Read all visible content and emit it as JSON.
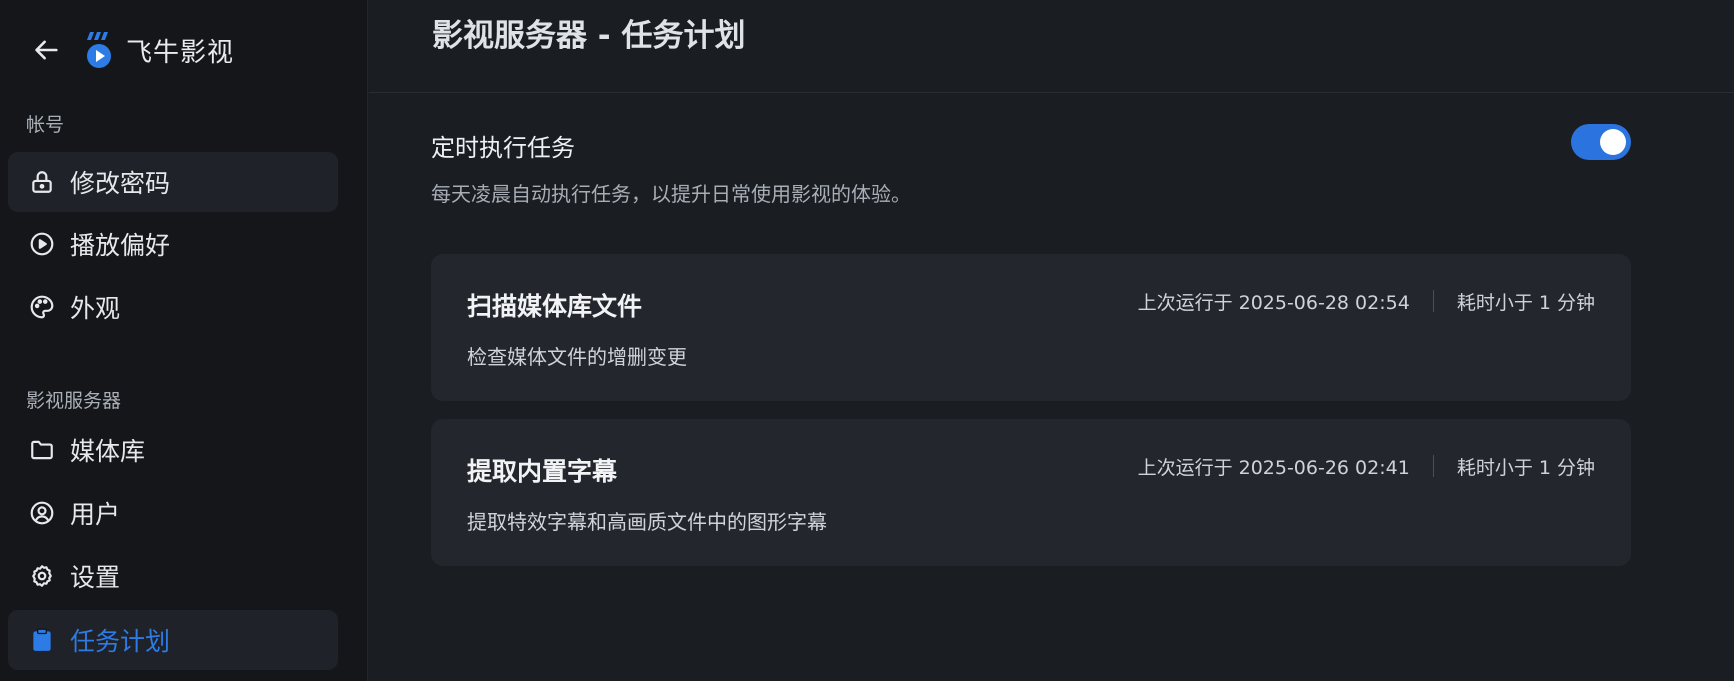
{
  "brand": {
    "name": "飞牛影视"
  },
  "sidebar": {
    "sections": [
      {
        "label": "帐号"
      },
      {
        "label": "影视服务器"
      }
    ],
    "items": [
      {
        "label": "修改密码",
        "icon": "lock-icon"
      },
      {
        "label": "播放偏好",
        "icon": "play-circle-icon"
      },
      {
        "label": "外观",
        "icon": "palette-icon"
      },
      {
        "label": "媒体库",
        "icon": "folder-icon"
      },
      {
        "label": "用户",
        "icon": "user-circle-icon"
      },
      {
        "label": "设置",
        "icon": "gear-icon"
      },
      {
        "label": "任务计划",
        "icon": "clipboard-icon"
      }
    ],
    "active_item": "任务计划"
  },
  "header": {
    "title": "影视服务器 - 任务计划"
  },
  "schedule": {
    "title": "定时执行任务",
    "description": "每天凌晨自动执行任务，以提升日常使用影视的体验。",
    "enabled": true
  },
  "tasks": [
    {
      "name": "扫描媒体库文件",
      "description": "检查媒体文件的增删变更",
      "last_run": "上次运行于 2025-06-28 02:54",
      "duration": "耗时小于 1 分钟"
    },
    {
      "name": "提取内置字幕",
      "description": "提取特效字幕和高画质文件中的图形字幕",
      "last_run": "上次运行于 2025-06-26 02:41",
      "duration": "耗时小于 1 分钟"
    }
  ],
  "colors": {
    "accent": "#2b74e0",
    "background": "#1a1d22",
    "sidebar": "#141619",
    "card": "#23262c"
  }
}
